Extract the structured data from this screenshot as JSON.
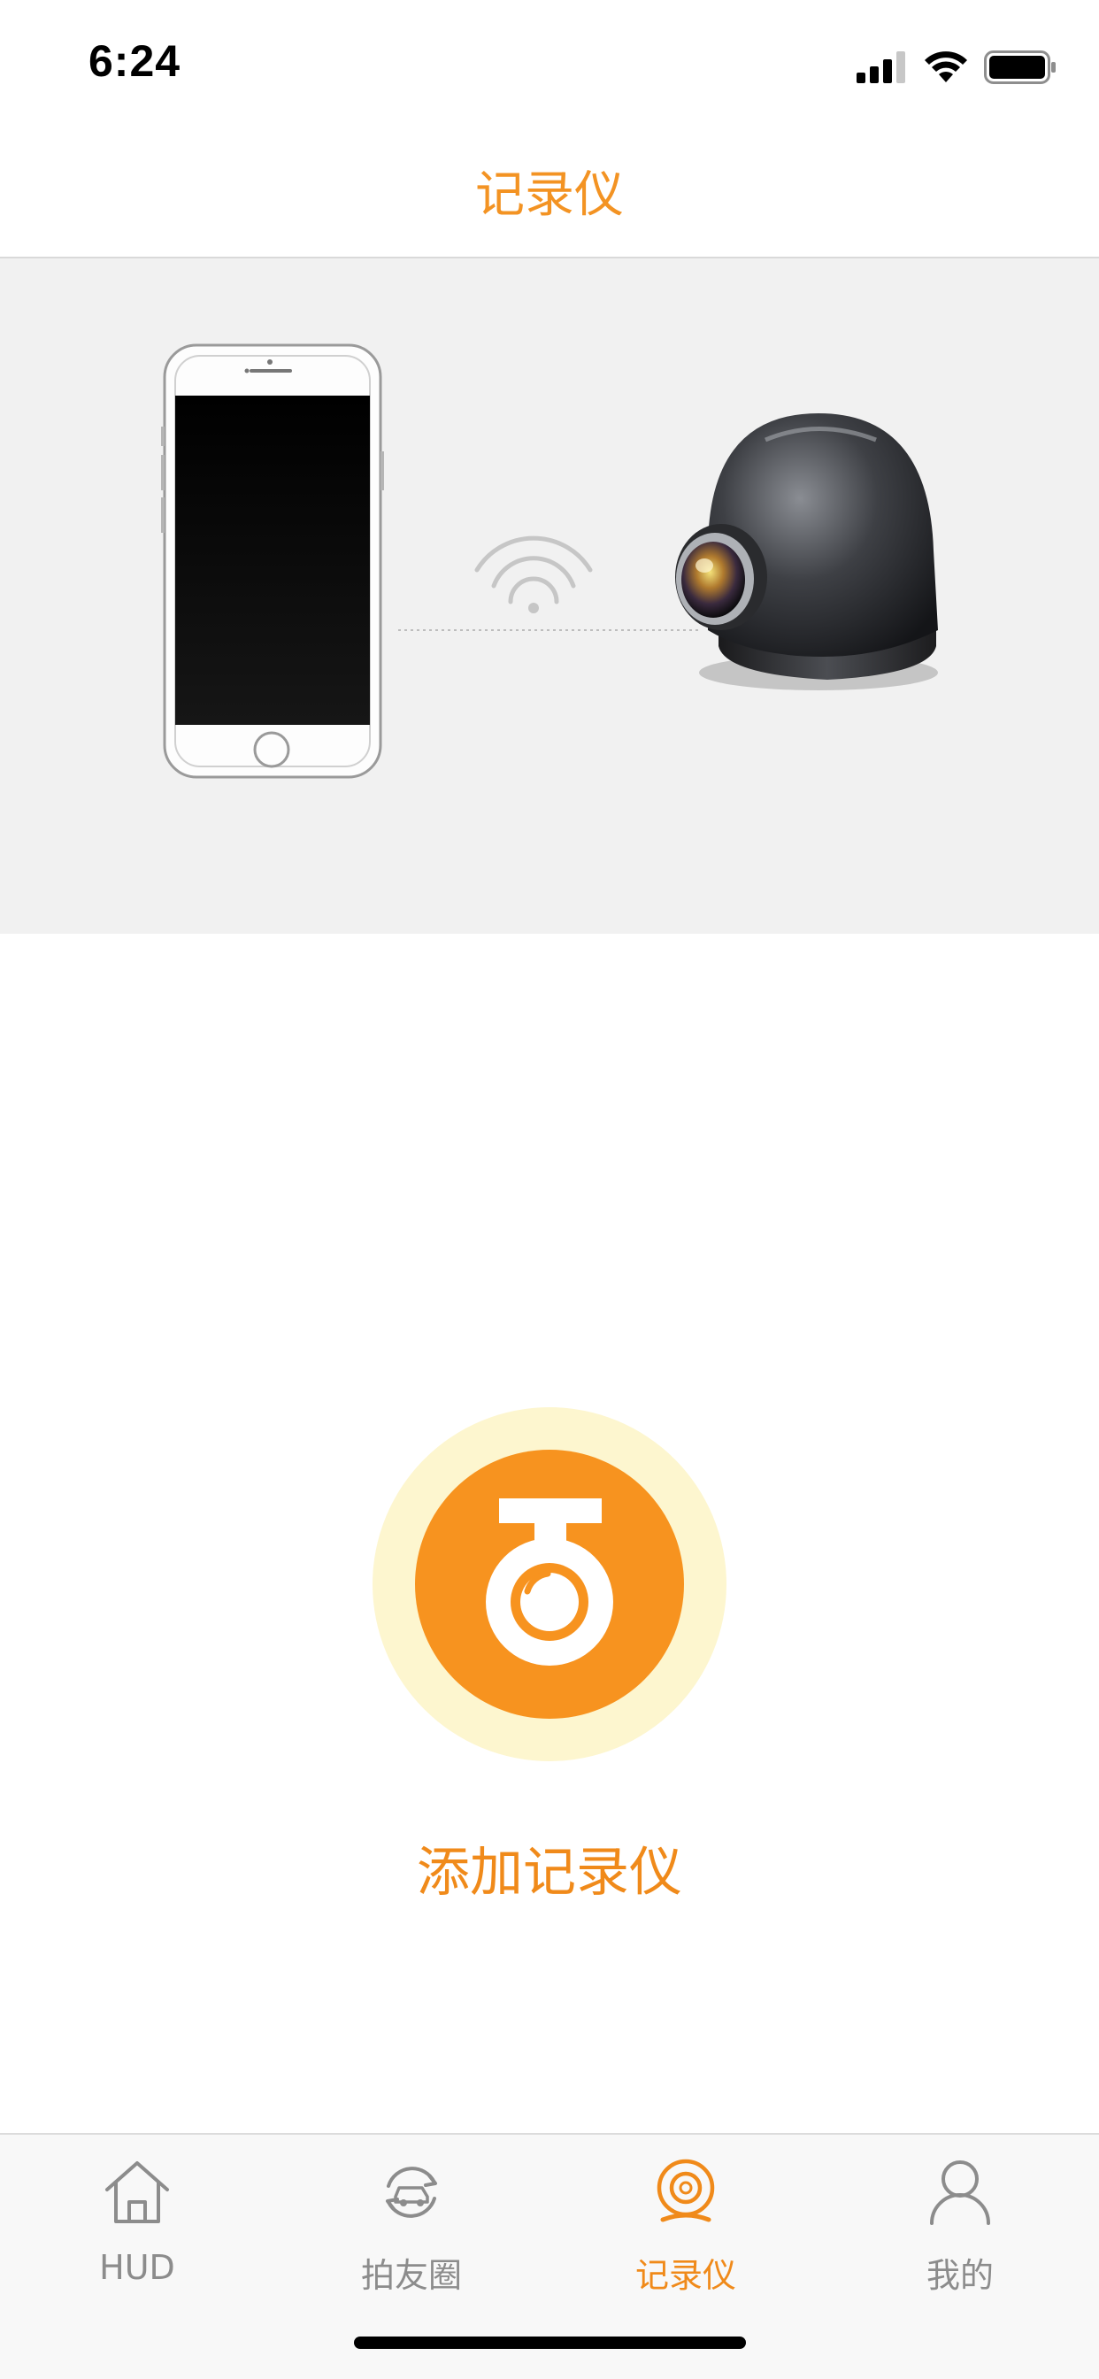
{
  "status_bar": {
    "time": "6:24"
  },
  "header": {
    "title": "记录仪"
  },
  "main": {
    "add_label": "添加记录仪"
  },
  "tab_bar": {
    "tabs": [
      {
        "label": "HUD",
        "icon": "home-icon",
        "active": false
      },
      {
        "label": "拍友圈",
        "icon": "car-share-icon",
        "active": false
      },
      {
        "label": "记录仪",
        "icon": "dashcam-icon",
        "active": true
      },
      {
        "label": "我的",
        "icon": "user-icon",
        "active": false
      }
    ]
  },
  "colors": {
    "accent": "#f39323",
    "accent_light": "#fdf6cf",
    "banner_bg": "#f1f1f1",
    "inactive_tab": "#8c8c8c"
  }
}
